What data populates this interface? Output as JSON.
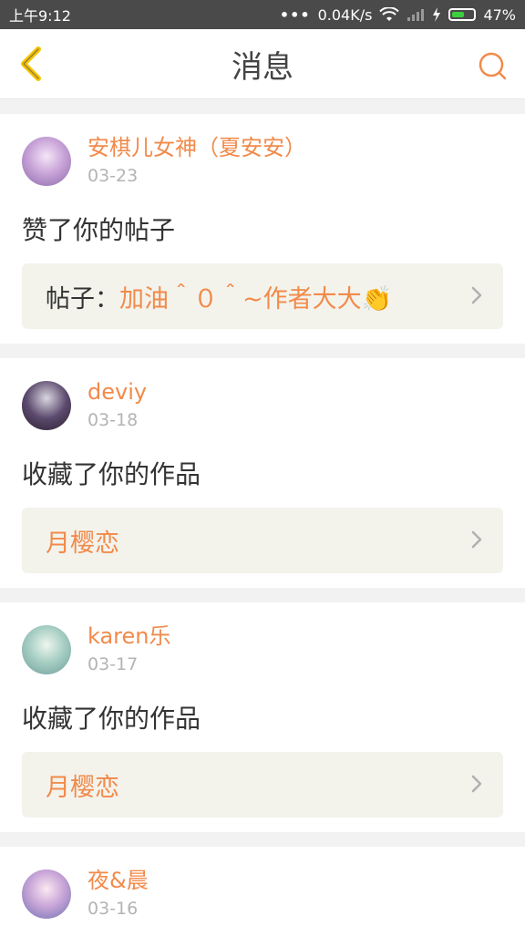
{
  "status_bar": {
    "time": "上午9:12",
    "dots": "•••",
    "speed": "0.04K/s",
    "battery": "47%"
  },
  "header": {
    "title": "消息"
  },
  "messages": [
    {
      "user": "安棋儿女神（夏安安）",
      "date": "03-23",
      "action": "赞了你的帖子",
      "target_prefix": "帖子：",
      "target_text": "加油＾０＾~作者大大👏"
    },
    {
      "user": "deviy",
      "date": "03-18",
      "action": "收藏了你的作品",
      "target_prefix": "",
      "target_text": "月樱恋"
    },
    {
      "user": "karen乐",
      "date": "03-17",
      "action": "收藏了你的作品",
      "target_prefix": "",
      "target_text": "月樱恋"
    },
    {
      "user": "夜&晨",
      "date": "03-16",
      "action": "",
      "target_prefix": "",
      "target_text": ""
    }
  ],
  "colors": {
    "accent": "#f28a4a",
    "back_arrow": "#f5c400",
    "status_bg": "#4a4a4a"
  }
}
